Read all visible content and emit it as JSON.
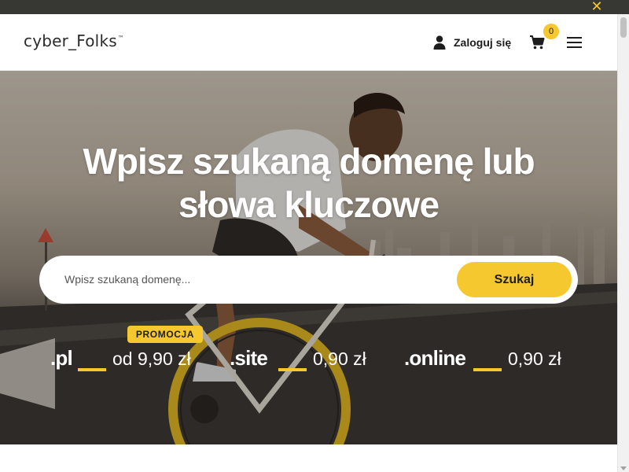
{
  "topbar": {
    "close_icon": "close-icon"
  },
  "header": {
    "logo_text": "cyber_Folks",
    "logo_tm": "™",
    "login_label": "Zaloguj się",
    "cart_count": "0",
    "accent_color": "#f5c830"
  },
  "hero": {
    "title_line1": "Wpisz szukaną domenę lub",
    "title_line2": "słowa kluczowe",
    "search_placeholder": "Wpisz szukaną domenę...",
    "search_button": "Szukaj",
    "promo_badge": "PROMOCJA",
    "tlds": [
      {
        "name": ".pl",
        "price": "od 9,90 zł"
      },
      {
        "name": ".site",
        "price": "0,90 zł"
      },
      {
        "name": ".online",
        "price": "0,90 zł"
      }
    ]
  }
}
